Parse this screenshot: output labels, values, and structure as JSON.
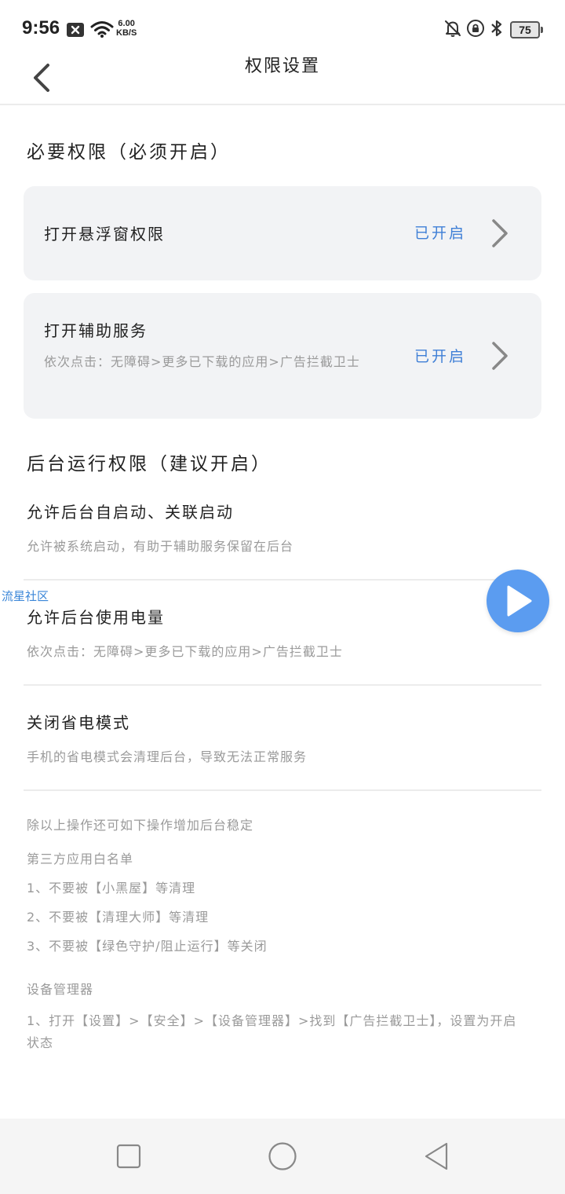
{
  "status_bar": {
    "time": "9:56",
    "network_speed_value": "6.00",
    "network_speed_unit": "KB/S",
    "battery_level": "75",
    "icons": [
      "close-box-icon",
      "wifi-icon",
      "bell-off-icon",
      "lock-rotation-icon",
      "bluetooth-icon",
      "battery-icon"
    ]
  },
  "header": {
    "title": "权限设置",
    "back_icon": "chevron-left-icon"
  },
  "required_section": {
    "title": "必要权限（必须开启）",
    "cards": [
      {
        "title": "打开悬浮窗权限",
        "status": "已开启"
      },
      {
        "title": "打开辅助服务",
        "description": "依次点击：无障碍>更多已下载的应用>广告拦截卫士",
        "status": "已开启"
      }
    ]
  },
  "background_section": {
    "title": "后台运行权限（建议开启）",
    "items": [
      {
        "title": "允许后台自启动、关联启动",
        "description": "允许被系统启动，有助于辅助服务保留在后台"
      },
      {
        "title": "允许后台使用电量",
        "description": "依次点击：无障碍>更多已下载的应用>广告拦截卫士"
      },
      {
        "title": "关闭省电模式",
        "description": "手机的省电模式会清理后台，导致无法正常服务"
      }
    ]
  },
  "notes": {
    "intro": "除以上操作还可如下操作增加后台稳定",
    "whitelist_title": "第三方应用白名单",
    "whitelist_items": [
      "1、不要被【小黑屋】等清理",
      "2、不要被【清理大师】等清理",
      "3、不要被【绿色守护/阻止运行】等关闭"
    ],
    "device_admin_title": "设备管理器",
    "device_admin_items": [
      "1、打开【设置】>【安全】>【设备管理器】>找到【广告拦截卫士】，设置为开启状态"
    ]
  },
  "overlay": {
    "watermark": "流星社区",
    "play_icon": "play-icon"
  },
  "nav_bar": {
    "icons": [
      "square-recent-icon",
      "circle-home-icon",
      "triangle-back-icon"
    ]
  },
  "colors": {
    "accent": "#3f7fd6",
    "card_bg": "#f2f3f5",
    "secondary_text": "#9a9a9a",
    "play_button": "#5b9cf0"
  }
}
